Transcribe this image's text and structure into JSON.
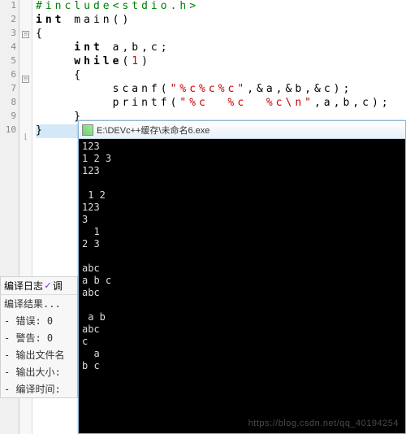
{
  "editor": {
    "lines": [
      "1",
      "2",
      "3",
      "4",
      "5",
      "6",
      "7",
      "8",
      "9",
      "10"
    ],
    "fold": [
      "",
      "",
      "⊟",
      "",
      "",
      "⊟",
      "",
      "",
      "",
      "⌊"
    ],
    "row1": "#include<stdio.h>",
    "row2_a": "int",
    "row2_b": " main()",
    "row3": "{",
    "row4_a": "    int",
    "row4_b": " a,b,c;",
    "row5_a": "    while",
    "row5_b": "(",
    "row5_c": "1",
    "row5_d": ")",
    "row6": "    {",
    "row7_a": "        scanf(",
    "row7_b": "\"%c%c%c\"",
    "row7_c": ",&a,&b,&c);",
    "row8_a": "        printf(",
    "row8_b": "\"%c  %c  %c\\n\"",
    "row8_c": ",a,b,c);",
    "row9": "    }",
    "row10": "}"
  },
  "panel": {
    "tab1": "编译日志",
    "tab2": "调",
    "result": "编译结果...",
    "errors_lbl": "- 错误:",
    "errors_val": "0",
    "warn_lbl": "- 警告:",
    "warn_val": "0",
    "outfile_lbl": "- 输出文件名",
    "outsize_lbl": "- 输出大小:",
    "time_lbl": "- 编译时间:"
  },
  "console": {
    "title": "E:\\DEVc++缓存\\未命名6.exe",
    "output": "123\n1 2 3\n123\n\n 1 2\n123\n3\n  1\n2 3\n\nabc\na b c\nabc\n\n a b\nabc\nc\n  a\nb c"
  },
  "watermark": "https://blog.csdn.net/qq_40194254"
}
